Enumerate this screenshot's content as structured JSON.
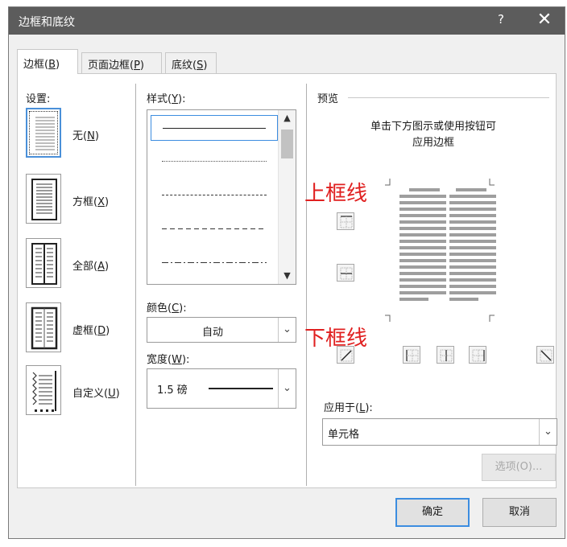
{
  "window": {
    "title": "边框和底纹",
    "help_glyph": "?",
    "close_glyph": "✕"
  },
  "tabs": [
    {
      "text": "边框(",
      "key": "B",
      "tail": ")"
    },
    {
      "text": "页面边框(",
      "key": "P",
      "tail": ")"
    },
    {
      "text": "底纹(",
      "key": "S",
      "tail": ")"
    }
  ],
  "settings": {
    "label": "设置:",
    "items": [
      {
        "text": "无(",
        "key": "N",
        "tail": ")"
      },
      {
        "text": "方框(",
        "key": "X",
        "tail": ")"
      },
      {
        "text": "全部(",
        "key": "A",
        "tail": ")"
      },
      {
        "text": "虚框(",
        "key": "D",
        "tail": ")"
      },
      {
        "text": "自定义(",
        "key": "U",
        "tail": ")"
      }
    ]
  },
  "style": {
    "label_text": "样式(",
    "label_key": "Y",
    "label_tail": "):"
  },
  "color": {
    "label_text": "颜色(",
    "label_key": "C",
    "label_tail": "):",
    "value": "自动"
  },
  "width": {
    "label_text": "宽度(",
    "label_key": "W",
    "label_tail": "):",
    "value": "1.5 磅"
  },
  "preview": {
    "label": "预览",
    "hint_line1": "单击下方图示或使用按钮可",
    "hint_line2": "应用边框"
  },
  "apply_to": {
    "label_text": "应用于(",
    "label_key": "L",
    "label_tail": "):",
    "value": "单元格"
  },
  "buttons": {
    "options": "选项(O)...",
    "ok": "确定",
    "cancel": "取消"
  },
  "annotations": {
    "top": "上框线",
    "bottom": "下框线"
  },
  "colors": {
    "titlebar": "#5c5c5c",
    "accent": "#3c8de0",
    "annotation": "#e02020"
  }
}
